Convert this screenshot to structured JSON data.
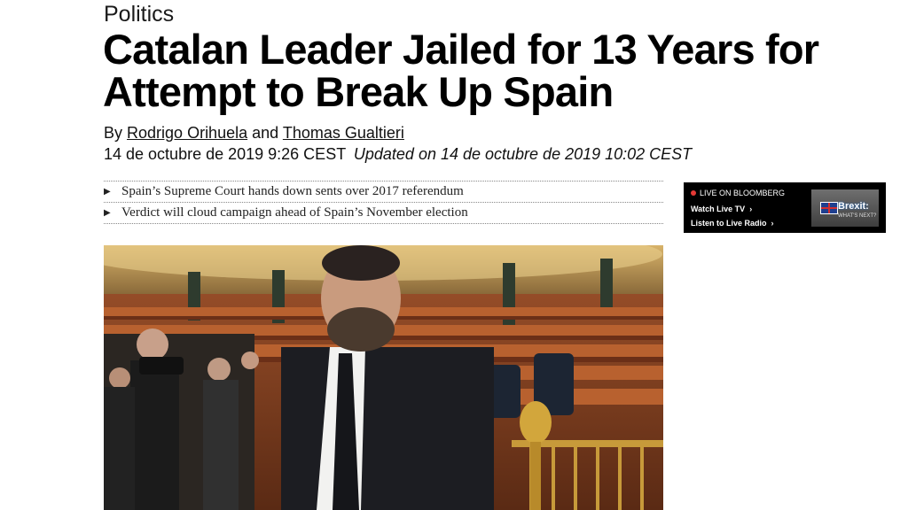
{
  "article": {
    "section": "Politics",
    "headline": "Catalan Leader Jailed for 13 Years for Attempt to Break Up Spain",
    "byline": {
      "prefix": "By",
      "author_1": "Rodrigo Orihuela",
      "conjunction": "and",
      "author_2": "Thomas Gualtieri"
    },
    "published": "14 de octubre de 2019 9:26 CEST",
    "updated": "Updated on 14 de octubre de 2019 10:02 CEST",
    "abstract": [
      "Spain’s Supreme Court hands down sents over 2017 referendum",
      "Verdict will cloud campaign ahead of Spain’s November election"
    ],
    "photo_icon": "news-photo"
  },
  "live_module": {
    "label": "LIVE ON BLOOMBERG",
    "watch_tv": "Watch Live TV",
    "listen_radio": "Listen to Live Radio",
    "thumbnail": {
      "title": "Brexit:",
      "subtitle": "WHAT'S NEXT?"
    },
    "live_color": "#e53935"
  }
}
